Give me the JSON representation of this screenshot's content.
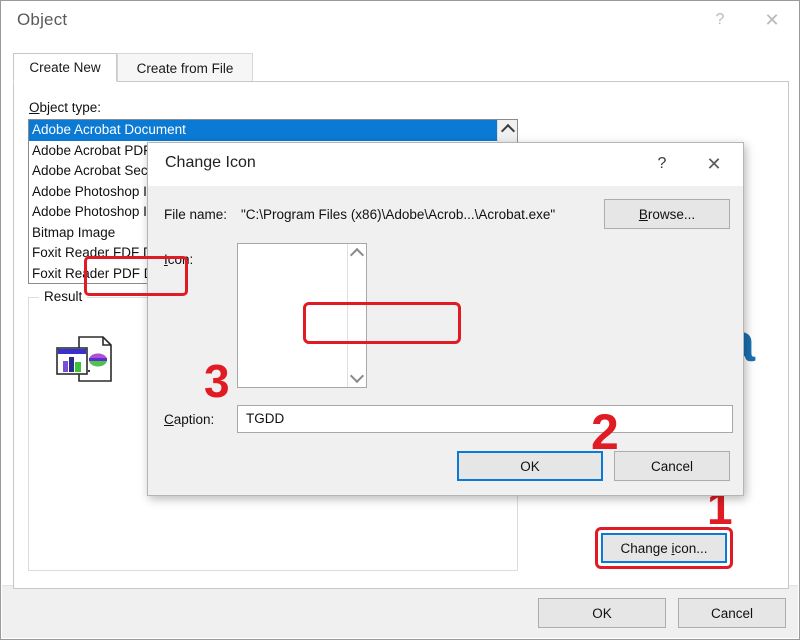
{
  "object_dialog": {
    "title": "Object",
    "help_label": "?",
    "close_label": "✕",
    "tabs": [
      {
        "label": "Create New",
        "selected": true
      },
      {
        "label": "Create from File",
        "selected": false
      }
    ],
    "object_type_label": "Object type:",
    "object_type_items": [
      {
        "label": "Adobe Acrobat Document",
        "selected": true
      },
      {
        "label": "Adobe Acrobat PDFXML Document",
        "selected": false
      },
      {
        "label": "Adobe Acrobat Security Settings Document",
        "selected": false
      },
      {
        "label": "Adobe Photoshop Image",
        "selected": false
      },
      {
        "label": "Adobe Photoshop Image 20.0",
        "selected": false
      },
      {
        "label": "Bitmap Image",
        "selected": false
      },
      {
        "label": "Foxit Reader FDF Document",
        "selected": false
      },
      {
        "label": "Foxit Reader PDF Document",
        "selected": false
      }
    ],
    "result_legend": "Result",
    "change_icon_label": "Change icon...",
    "ok_label": "OK",
    "cancel_label": "Cancel"
  },
  "change_icon_dialog": {
    "title": "Change Icon",
    "help_label": "?",
    "close_label": "✕",
    "file_name_label": "File name:",
    "file_name_value": "\"C:\\Program Files (x86)\\Adobe\\Acrob...\\Acrobat.exe\"",
    "browse_label": "Browse...",
    "icon_label": "Icon:",
    "caption_label": "Caption:",
    "caption_value": "TGDD",
    "ok_label": "OK",
    "cancel_label": "Cancel"
  },
  "annotations": {
    "step_1": "1",
    "step_2": "2",
    "step_3": "3",
    "highlight_color": "#e01b24"
  },
  "watermark": {
    "text": "unica",
    "orange": "#F08221",
    "blue": "#1A6FB0"
  }
}
